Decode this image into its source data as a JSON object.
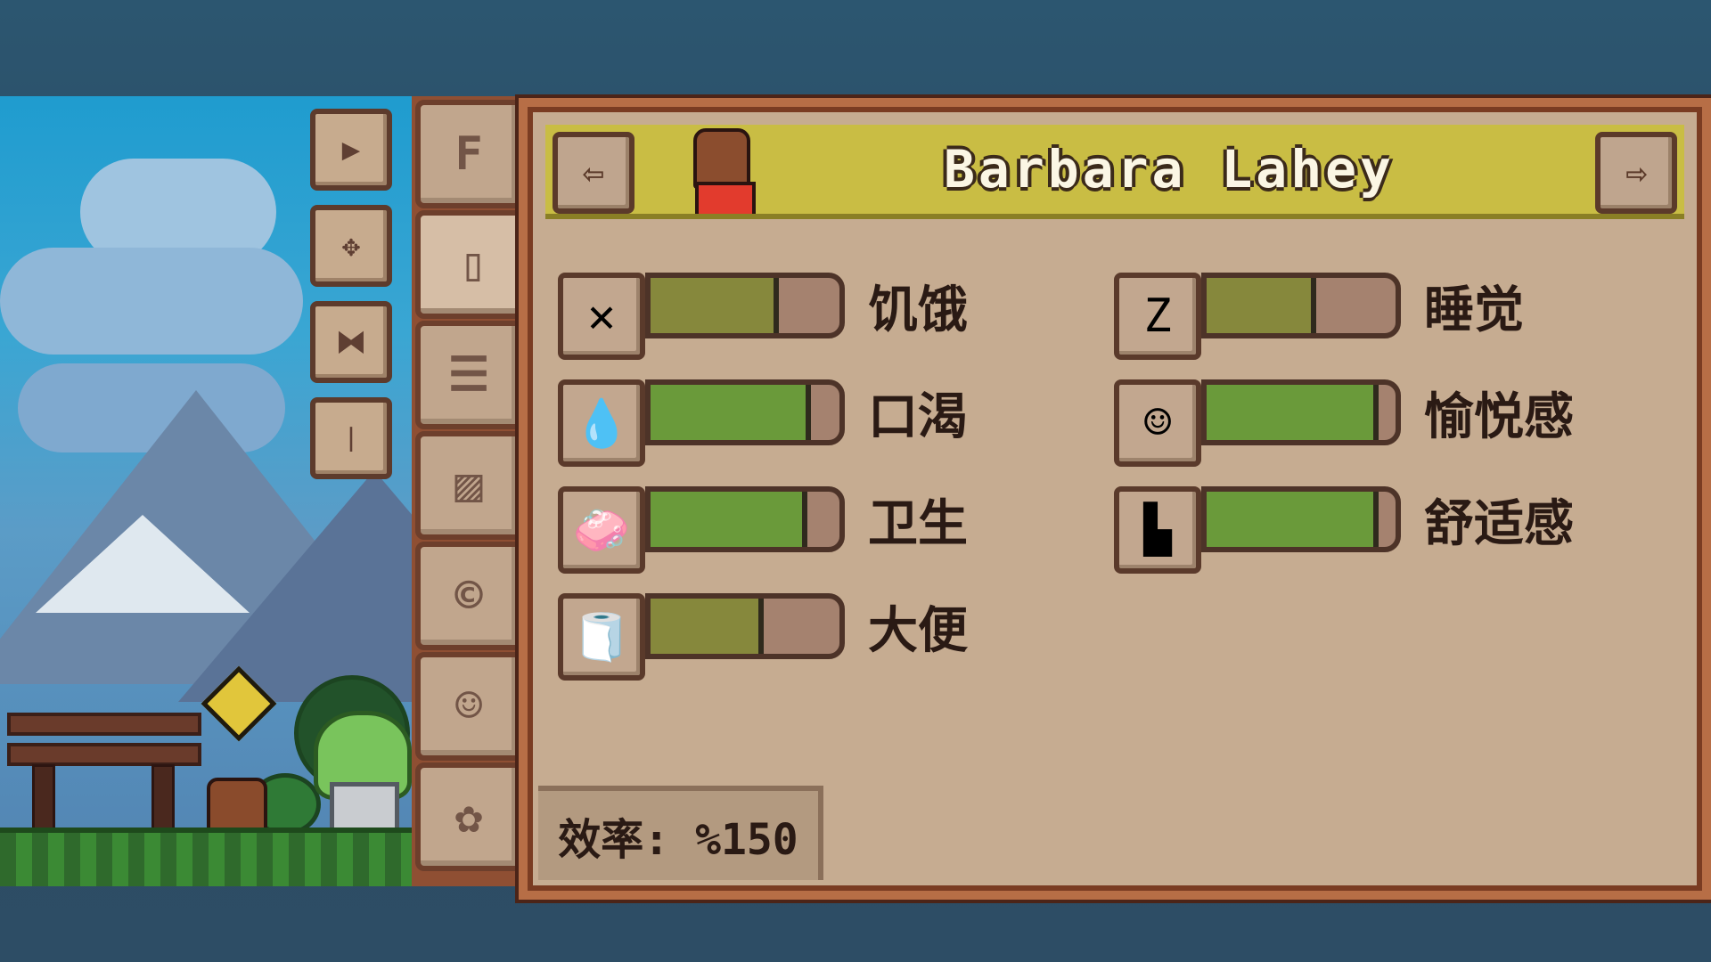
{
  "scene": {
    "speed_controls": [
      {
        "icon": "play-icon",
        "glyph": "▶"
      },
      {
        "icon": "fast-forward-icon",
        "glyph": "✥"
      },
      {
        "icon": "faster-icon",
        "glyph": "⧓"
      },
      {
        "icon": "pause-icon",
        "glyph": "❘"
      }
    ]
  },
  "tabs": [
    {
      "icon": "f-icon",
      "glyph": "F"
    },
    {
      "icon": "cup-icon",
      "glyph": "▯"
    },
    {
      "icon": "clipboard-icon",
      "glyph": "☰"
    },
    {
      "icon": "stripes-icon",
      "glyph": "▨"
    },
    {
      "icon": "coin-icon",
      "glyph": "©"
    },
    {
      "icon": "add-person-icon",
      "glyph": "☺"
    },
    {
      "icon": "add-pet-icon",
      "glyph": "✿"
    }
  ],
  "panel": {
    "character_name": "Barbara Lahey",
    "prev_glyph": "⇦",
    "next_glyph": "⇨",
    "needs_left": [
      {
        "label": "饥饿",
        "value": 0.65,
        "icon": "fork-knife-icon",
        "glyph": "✕",
        "status_color": "#86883c"
      },
      {
        "label": "口渴",
        "value": 0.82,
        "icon": "water-drop-icon",
        "glyph": "💧",
        "status_color": "#6a9a3a"
      },
      {
        "label": "卫生",
        "value": 0.8,
        "icon": "soap-icon",
        "glyph": "🧼",
        "status_color": "#6a9a3a"
      },
      {
        "label": "大便",
        "value": 0.57,
        "icon": "toilet-paper-icon",
        "glyph": "🧻",
        "status_color": "#86883c"
      }
    ],
    "needs_right": [
      {
        "label": "睡觉",
        "value": 0.55,
        "icon": "sleep-z-icon",
        "glyph": "Z",
        "status_color": "#86883c"
      },
      {
        "label": "愉悦感",
        "value": 0.88,
        "icon": "smiley-icon",
        "glyph": "☺",
        "status_color": "#6a9a3a"
      },
      {
        "label": "舒适感",
        "value": 0.88,
        "icon": "armchair-icon",
        "glyph": "▙",
        "status_color": "#6a9a3a"
      }
    ],
    "efficiency": "效率: %150"
  }
}
